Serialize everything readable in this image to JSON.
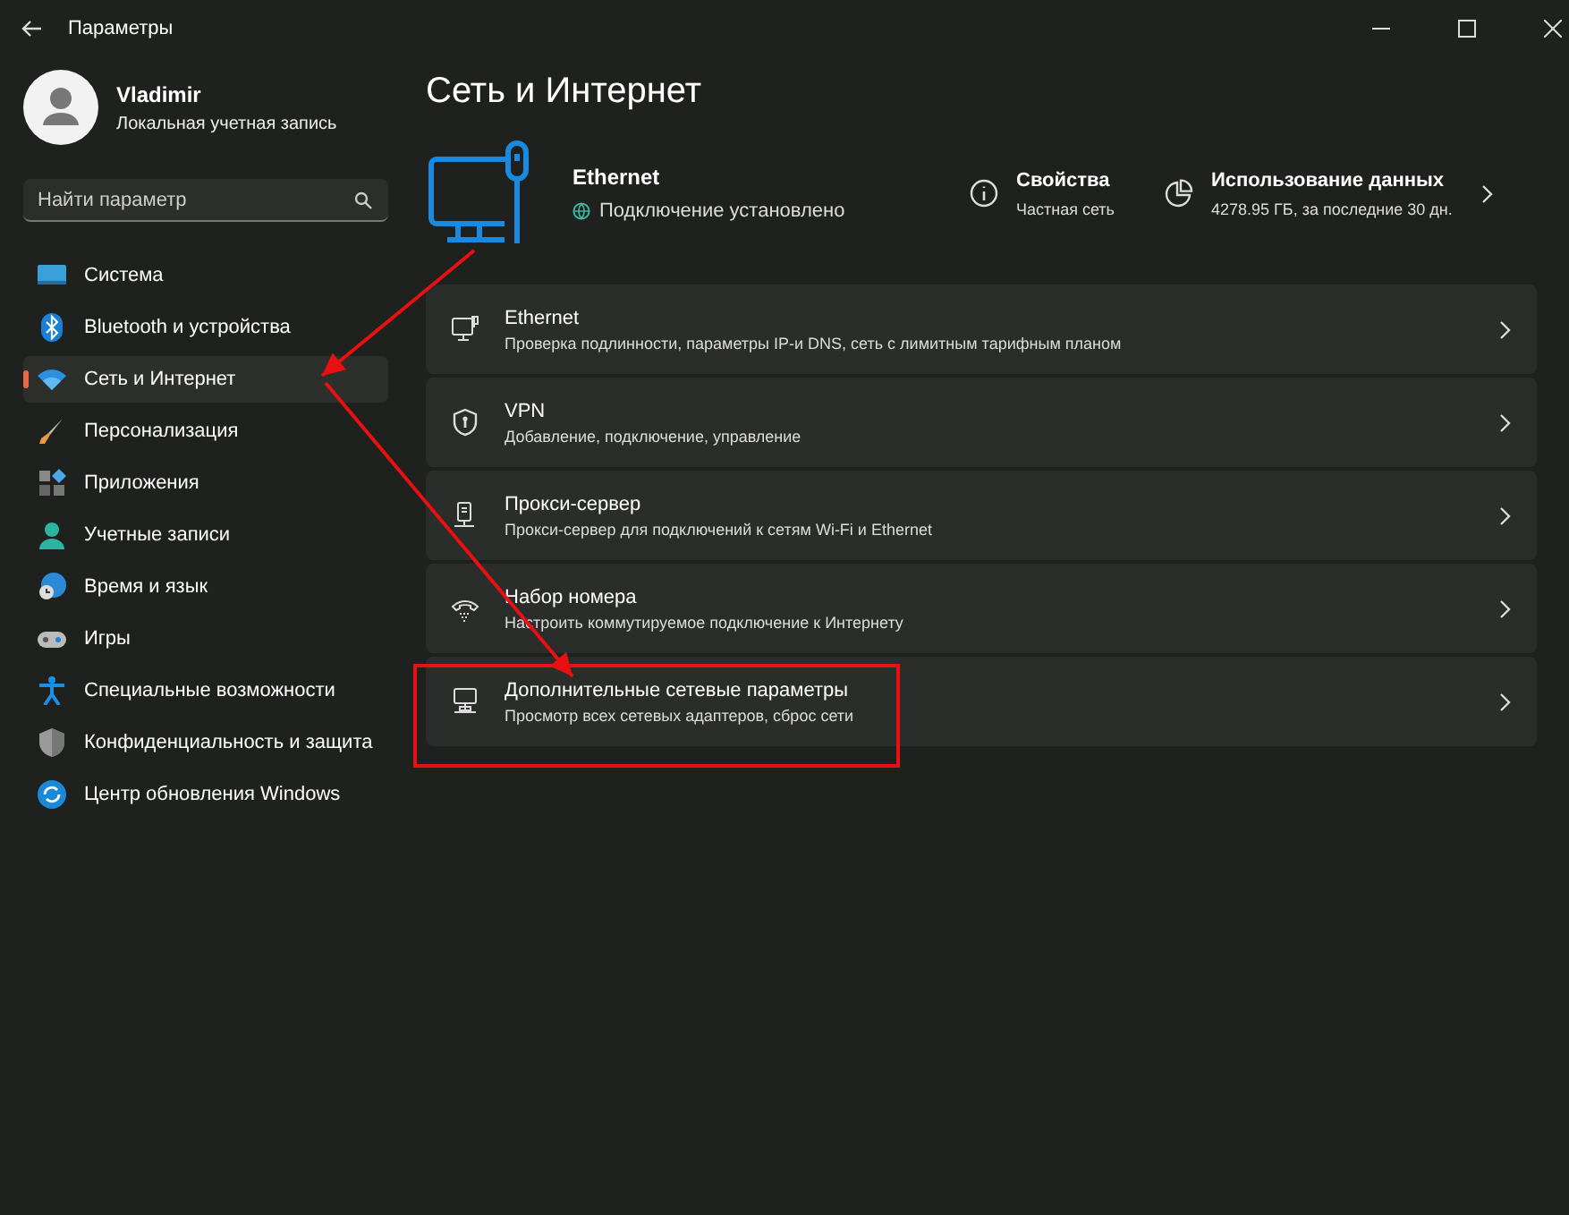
{
  "window": {
    "title": "Параметры",
    "controls": [
      {
        "kind": "minimize"
      },
      {
        "kind": "maximize"
      },
      {
        "kind": "close"
      }
    ]
  },
  "account": {
    "name": "Vladimir",
    "type": "Локальная учетная запись"
  },
  "search": {
    "placeholder": "Найти параметр"
  },
  "sidebar": {
    "items": [
      {
        "label": "Система",
        "selected": false
      },
      {
        "label": "Bluetooth и устройства",
        "selected": false
      },
      {
        "label": "Сеть и Интернет",
        "selected": true
      },
      {
        "label": "Персонализация",
        "selected": false
      },
      {
        "label": "Приложения",
        "selected": false
      },
      {
        "label": "Учетные записи",
        "selected": false
      },
      {
        "label": "Время и язык",
        "selected": false
      },
      {
        "label": "Игры",
        "selected": false
      },
      {
        "label": "Специальные возможности",
        "selected": false
      },
      {
        "label": "Конфиденциальность и защита",
        "selected": false
      },
      {
        "label": "Центр обновления Windows",
        "selected": false
      }
    ]
  },
  "page_title": "Сеть и Интернет",
  "connection": {
    "name": "Ethernet",
    "status": "Подключение установлено",
    "properties": {
      "title": "Свойства",
      "value": "Частная сеть"
    },
    "usage": {
      "title": "Использование данных",
      "value": "4278.95 ГБ, за последние 30 дн."
    }
  },
  "cards": [
    {
      "title": "Ethernet",
      "subtitle": "Проверка подлинности, параметры IP-и DNS, сеть с лимитным тарифным планом"
    },
    {
      "title": "VPN",
      "subtitle": "Добавление, подключение, управление"
    },
    {
      "title": "Прокси-сервер",
      "subtitle": "Прокси-сервер для подключений к сетям Wi-Fi и Ethernet"
    },
    {
      "title": "Набор номера",
      "subtitle": "Настроить коммутируемое подключение к Интернету"
    },
    {
      "title": "Дополнительные сетевые параметры",
      "subtitle": "Просмотр всех сетевых адаптеров, сброс сети"
    }
  ],
  "annotations": [
    {
      "kind": "arrow"
    },
    {
      "kind": "arrow"
    },
    {
      "kind": "highlight"
    }
  ]
}
